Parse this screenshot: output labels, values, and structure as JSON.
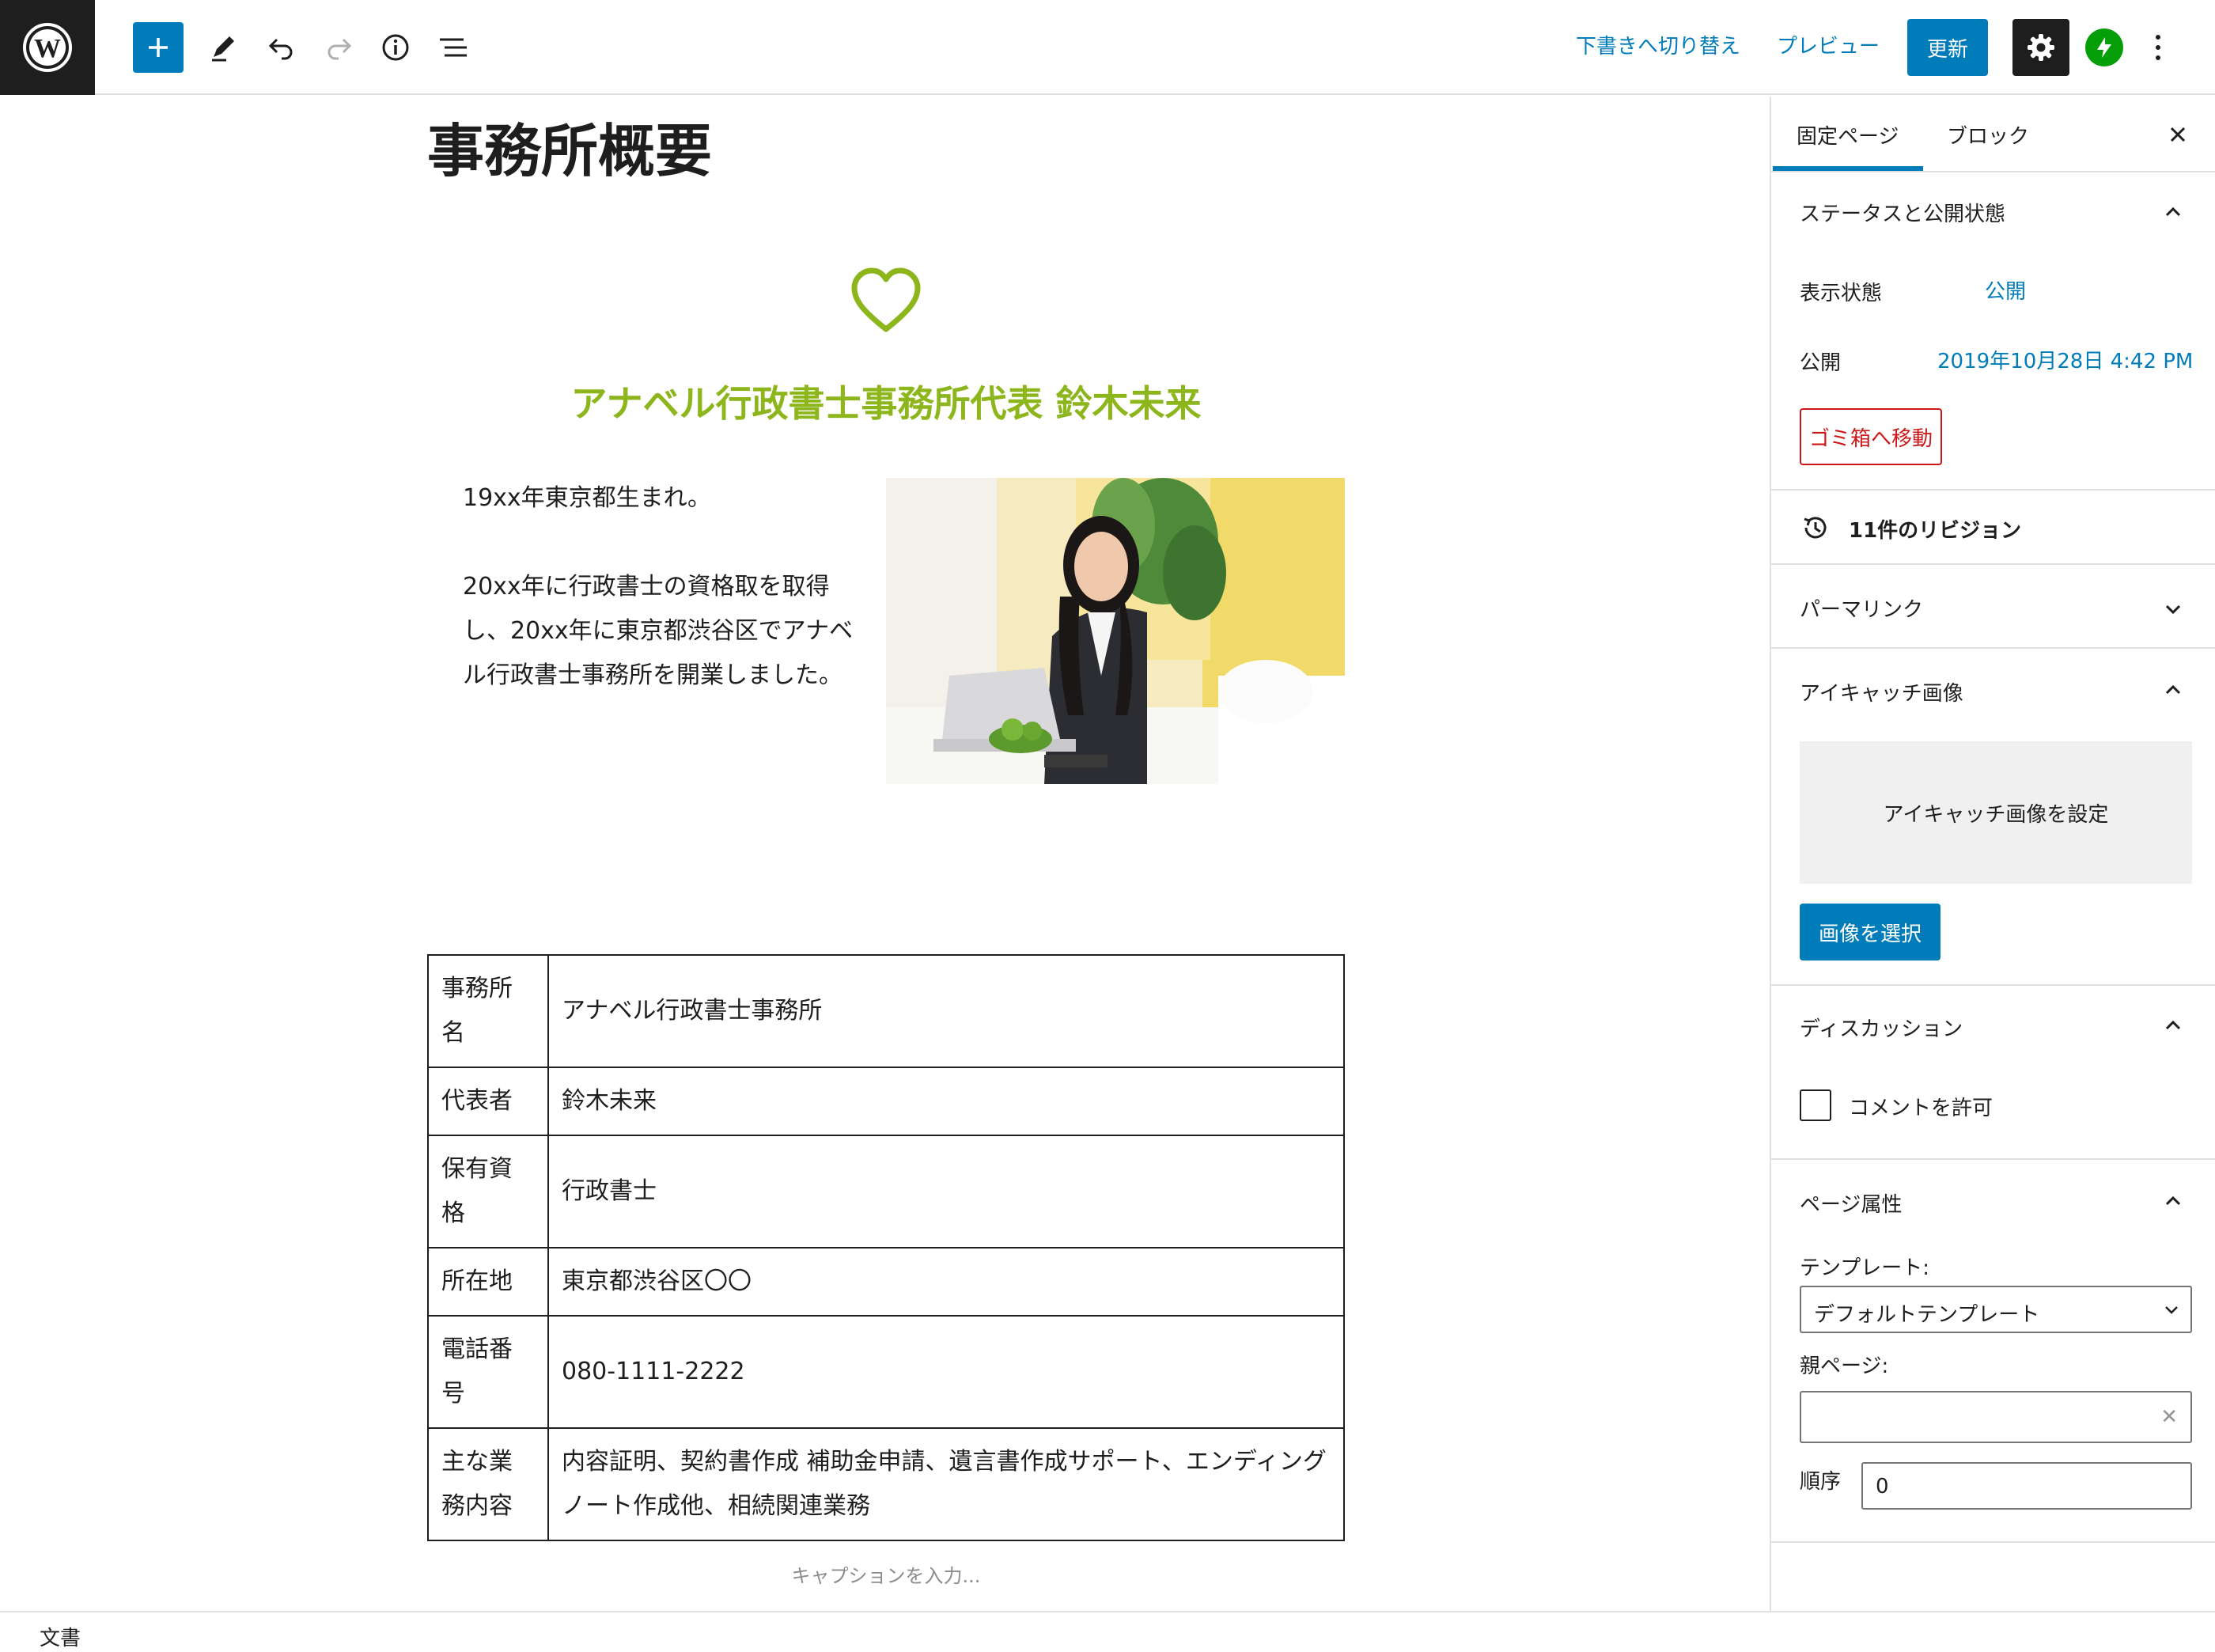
{
  "topbar": {
    "switch_draft": "下書きへ切り替え",
    "preview": "プレビュー",
    "update": "更新"
  },
  "editor": {
    "title": "事務所概要",
    "subheading": "アナベル行政書士事務所代表 鈴木未来",
    "bio": [
      "19xx年東京都生まれ。",
      "20xx年に行政書士の資格取を取得し、20xx年に東京都渋谷区でアナベル行政書士事務所を開業しました。"
    ],
    "table": [
      {
        "key": "事務所名",
        "value": "アナベル行政書士事務所"
      },
      {
        "key": "代表者",
        "value": "鈴木未来"
      },
      {
        "key": "保有資格",
        "value": "行政書士"
      },
      {
        "key": "所在地",
        "value": "東京都渋谷区〇〇"
      },
      {
        "key": "電話番号",
        "value": "080-1111-2222"
      },
      {
        "key": "主な業務内容",
        "value": "内容証明、契約書作成 補助金申請、遺言書作成サポート、エンディングノート作成他、相続関連業務"
      }
    ],
    "caption_placeholder": "キャプションを入力..."
  },
  "sidebar": {
    "tabs": [
      "固定ページ",
      "ブロック"
    ],
    "status": {
      "title": "ステータスと公開状態",
      "visibility_label": "表示状態",
      "visibility_value": "公開",
      "publish_label": "公開",
      "publish_value": "2019年10月28日 4:42 PM",
      "trash": "ゴミ箱へ移動"
    },
    "revisions": "11件のリビジョン",
    "permalink": "パーマリンク",
    "featured": {
      "title": "アイキャッチ画像",
      "set": "アイキャッチ画像を設定",
      "select": "画像を選択"
    },
    "discussion": {
      "title": "ディスカッション",
      "allow_comments": "コメントを許可"
    },
    "page_attributes": {
      "title": "ページ属性",
      "template_label": "テンプレート:",
      "template_value": "デフォルトテンプレート",
      "parent_label": "親ページ:",
      "order_label": "順序",
      "order_value": "0"
    }
  },
  "footer": {
    "breadcrumb": "文書"
  },
  "colors": {
    "accent": "#007cba",
    "green": "#8cb61b",
    "danger": "#cc1818"
  }
}
